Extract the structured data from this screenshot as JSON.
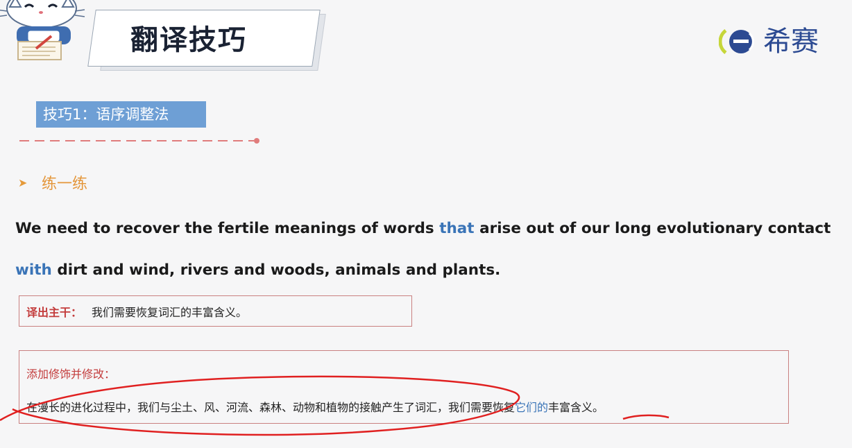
{
  "header": {
    "title": "翻译技巧",
    "logo_text": "希赛"
  },
  "section": {
    "tag": "技巧1：语序调整法",
    "practice_label": "练一练"
  },
  "sentence": {
    "part1": "We need to recover the fertile meanings of words ",
    "hl1": "that",
    "part2": " arise out of our long evolutionary contact",
    "hl2": "with",
    "part3": " dirt and wind, rivers and woods, animals and plants."
  },
  "box1": {
    "label": "译出主干：",
    "text": "我们需要恢复词汇的丰富含义。"
  },
  "box2": {
    "label": "添加修饰并修改：",
    "text_before": "在漫长的进化过程中，我们与尘土、风、河流、森林、动物和植物的接触产生了词汇，我们需要恢复",
    "text_highlight": "它们的",
    "text_after": "丰富含义。"
  },
  "colors": {
    "tag_bg": "#6e9fd5",
    "accent_orange": "#e4963a",
    "highlight_blue": "#3a74b7",
    "box_border": "#c98080",
    "ink_red": "#e02020"
  }
}
